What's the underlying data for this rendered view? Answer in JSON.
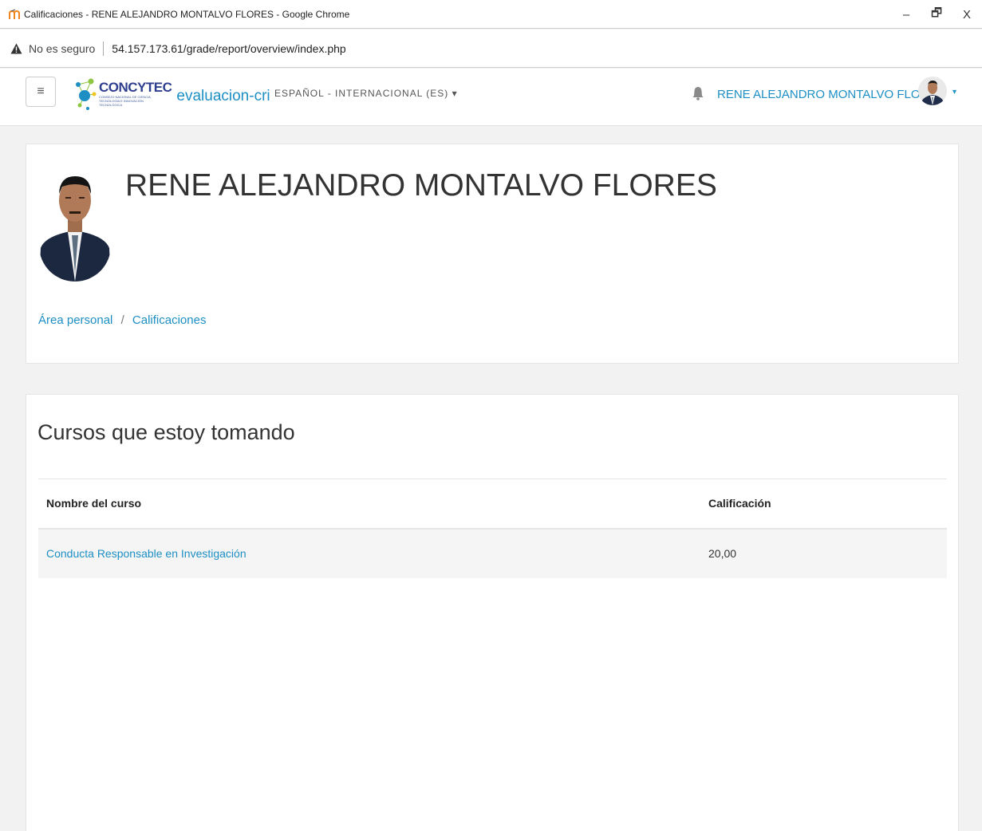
{
  "browser": {
    "window_title": "Calificaciones - RENE ALEJANDRO MONTALVO FLORES - Google Chrome",
    "security_label": "No es seguro",
    "url": "54.157.173.61/grade/report/overview/index.php",
    "controls": {
      "minimize": "–",
      "restore": "🗗",
      "close": "X"
    }
  },
  "navbar": {
    "menu_icon": "≡",
    "brand_name": "CONCYTEC",
    "brand_subtitle": "CONSEJO NACIONAL DE CIENCIA, TECNOLOGÍA E INNOVACIÓN TECNOLÓGICA",
    "site_name": "evaluacion-cri",
    "language": "ESPAÑOL - INTERNACIONAL (ES)",
    "language_caret": "▾",
    "user_name": "RENE ALEJANDRO MONTALVO FLORES",
    "user_caret": "▾"
  },
  "header": {
    "full_name": "RENE ALEJANDRO MONTALVO FLORES",
    "breadcrumb": [
      "Área personal",
      "Calificaciones"
    ],
    "breadcrumb_separator": "/"
  },
  "courses": {
    "title": "Cursos que estoy tomando",
    "columns": [
      "Nombre del curso",
      "Calificación"
    ],
    "rows": [
      {
        "course": "Conducta Responsable en Investigación",
        "grade": "20,00"
      }
    ]
  },
  "colors": {
    "link": "#1d8fc4",
    "brand_blue": "#2f3f8f",
    "page_bg": "#f2f2f2",
    "row_bg": "#f5f5f5"
  }
}
